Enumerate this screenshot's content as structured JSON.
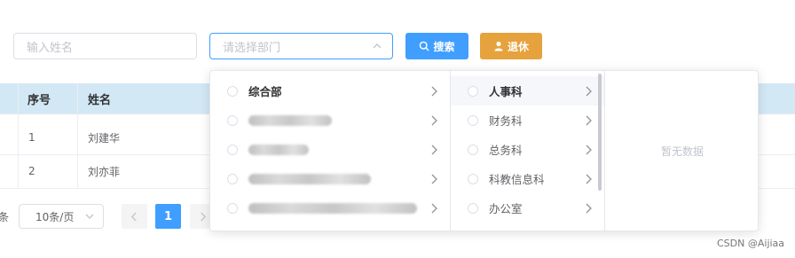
{
  "filters": {
    "name_placeholder": "输入姓名",
    "dept_placeholder": "请选择部门",
    "search_label": "搜索",
    "retire_label": "退休"
  },
  "table": {
    "headers": [
      "序号",
      "姓名"
    ],
    "rows": [
      {
        "index": "1",
        "name": "刘建华"
      },
      {
        "index": "2",
        "name": "刘亦菲"
      }
    ]
  },
  "pagination": {
    "total_suffix": "条",
    "page_size": "10条/页",
    "prev_icon": "chevron-left-icon",
    "current_page": "1",
    "next_icon": "chevron-right-icon"
  },
  "cascader": {
    "level1": [
      {
        "label": "综合部"
      },
      {
        "label": ""
      },
      {
        "label": ""
      },
      {
        "label": ""
      },
      {
        "label": ""
      }
    ],
    "level2": [
      {
        "label": "人事科",
        "active": true
      },
      {
        "label": "财务科"
      },
      {
        "label": "总务科"
      },
      {
        "label": "科教信息科"
      },
      {
        "label": "办公室"
      }
    ],
    "empty_text": "暂无数据"
  },
  "watermark": "CSDN @Aijiaa",
  "colors": {
    "primary": "#409eff",
    "warning": "#e6a23c",
    "table_header_bg": "#d3e8f5"
  }
}
